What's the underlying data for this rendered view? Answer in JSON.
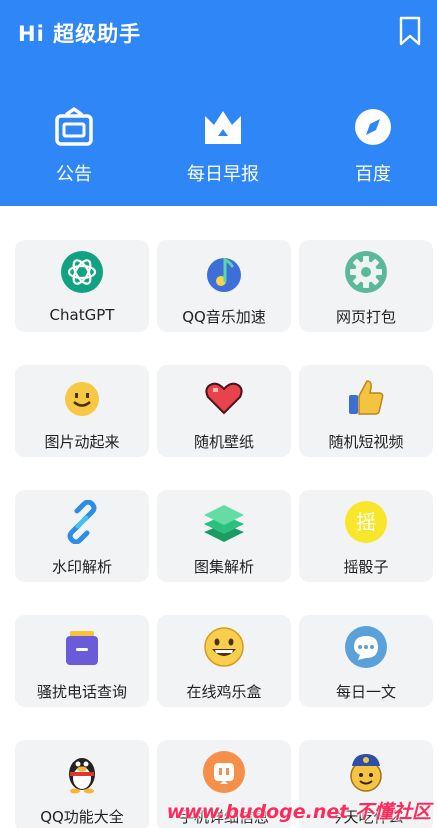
{
  "header": {
    "title": "Hi 超级助手",
    "bookmark_icon": "bookmark-icon",
    "quick_links": [
      {
        "label": "公告",
        "icon": "announcement-icon"
      },
      {
        "label": "每日早报",
        "icon": "crown-icon"
      },
      {
        "label": "百度",
        "icon": "compass-icon"
      }
    ]
  },
  "tools": [
    {
      "label": "ChatGPT",
      "icon": "chatgpt-icon"
    },
    {
      "label": "QQ音乐加速",
      "icon": "music-icon"
    },
    {
      "label": "网页打包",
      "icon": "gear-icon"
    },
    {
      "label": "图片动起来",
      "icon": "smile-icon"
    },
    {
      "label": "随机壁纸",
      "icon": "heart-icon"
    },
    {
      "label": "随机短视频",
      "icon": "thumbs-up-icon"
    },
    {
      "label": "水印解析",
      "icon": "link-icon"
    },
    {
      "label": "图集解析",
      "icon": "layers-icon"
    },
    {
      "label": "摇骰子",
      "icon": "shake-icon",
      "icon_text": "摇"
    },
    {
      "label": "骚扰电话查询",
      "icon": "box-icon"
    },
    {
      "label": "在线鸡乐盒",
      "icon": "grin-icon"
    },
    {
      "label": "每日一文",
      "icon": "chat-bubble-icon"
    },
    {
      "label": "QQ功能大全",
      "icon": "penguin-icon"
    },
    {
      "label": "手机详细信息",
      "icon": "robot-icon"
    },
    {
      "label": "今天吃什么",
      "icon": "chef-icon"
    }
  ],
  "watermark": "www.budoge.net 不懂社区",
  "colors": {
    "header": "#2f86f6",
    "tile": "#f2f3f5"
  }
}
